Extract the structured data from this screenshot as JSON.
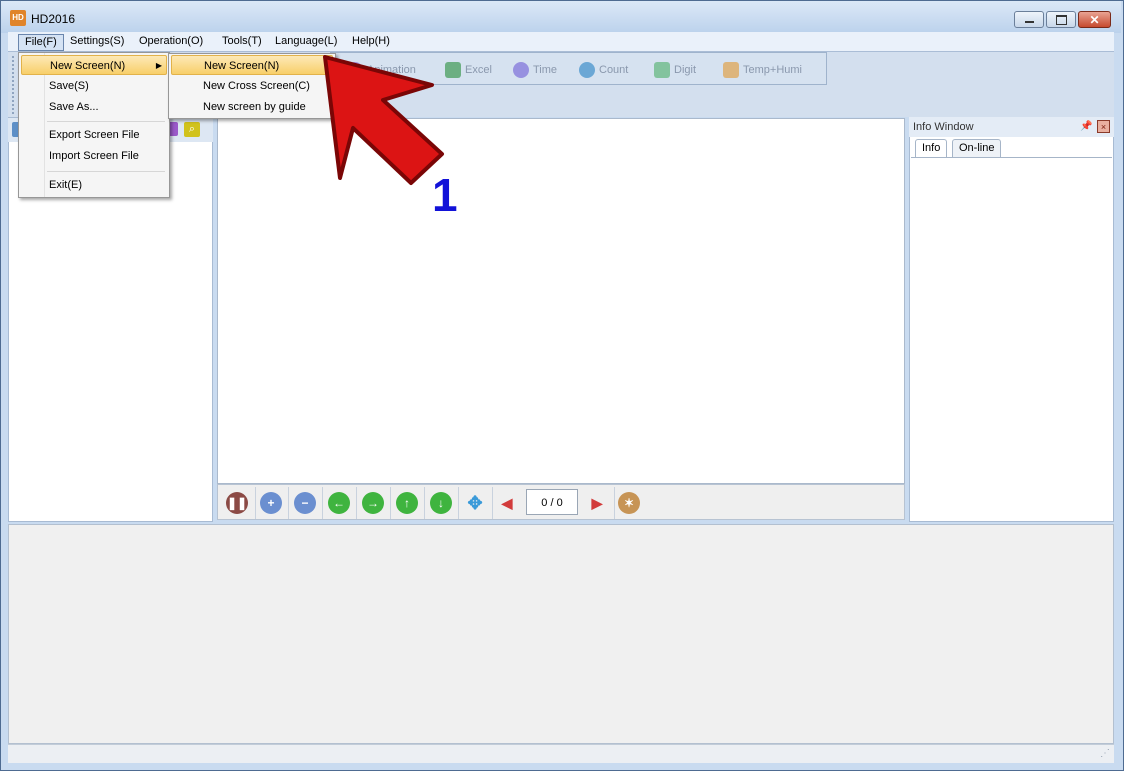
{
  "window": {
    "title": "HD2016"
  },
  "menubar": [
    {
      "label": "File(F)"
    },
    {
      "label": "Settings(S)"
    },
    {
      "label": "Operation(O)"
    },
    {
      "label": "Tools(T)"
    },
    {
      "label": "Language(L)"
    },
    {
      "label": "Help(H)"
    }
  ],
  "file_menu": {
    "new_screen": "New Screen(N)",
    "save": "Save(S)",
    "save_as": "Save As...",
    "export": "Export Screen File",
    "import": "Import Screen File",
    "exit": "Exit(E)"
  },
  "submenu": {
    "new_screen": "New Screen(N)",
    "new_cross": "New Cross Screen(C)",
    "new_guide": "New screen by guide"
  },
  "toolbar": {
    "animation": "Animation",
    "excel": "Excel",
    "time": "Time",
    "count": "Count",
    "digit": "Digit",
    "temp": "Temp+Humi"
  },
  "navbar": {
    "page_counter": "0 / 0"
  },
  "info_window": {
    "title": "Info Window",
    "tabs": [
      {
        "label": "Info"
      },
      {
        "label": "On-line"
      }
    ]
  },
  "annotation": {
    "number": "1"
  },
  "colors": {
    "highlight": "#f8cf6a",
    "arrow": "#e01010",
    "annotation_number": "#1212d8"
  },
  "icons": [
    "app-icon",
    "minimize-icon",
    "maximize-icon",
    "close-icon",
    "pause-icon",
    "zoom-in-icon",
    "zoom-out-icon",
    "arrow-left-icon",
    "arrow-right-icon",
    "arrow-up-icon",
    "arrow-down-icon",
    "move-icon",
    "play-back-icon",
    "play-icon",
    "settings-icon",
    "pin-icon"
  ]
}
